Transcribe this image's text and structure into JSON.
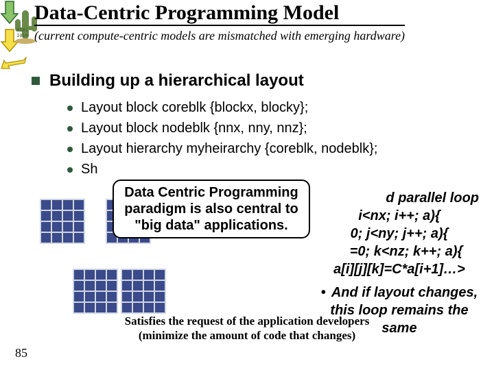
{
  "title": "Data-Centric Programming Model",
  "subtitle": "(current compute-centric models are mismatched with emerging hardware)",
  "section_heading": "Building up a hierarchical layout",
  "code_lines": [
    "Layout block coreblk {blockx, blocky};",
    "Layout block nodeblk {nnx, nny, nnz};",
    "Layout hierarchy myheirarchy {coreblk, nodeblk};",
    "Sh"
  ],
  "callout_text": "Data Centric Programming paradigm is also central to \"big data\" applications.",
  "right_block": {
    "line1_fragment": "d parallel loop",
    "code1": "i<nx; i++;  a){",
    "code2": "0; j<ny; j++;  a){",
    "code3": "=0; k<nz; k++;  a){",
    "code4": "a[i][j][k]=C*a[i+1]…>",
    "note": "And if layout changes, this loop remains the same"
  },
  "footer_caption_line1": "Satisfies the request of the application developers",
  "footer_caption_line2": "(minimize the amount of code that changes)",
  "page_number": "85"
}
